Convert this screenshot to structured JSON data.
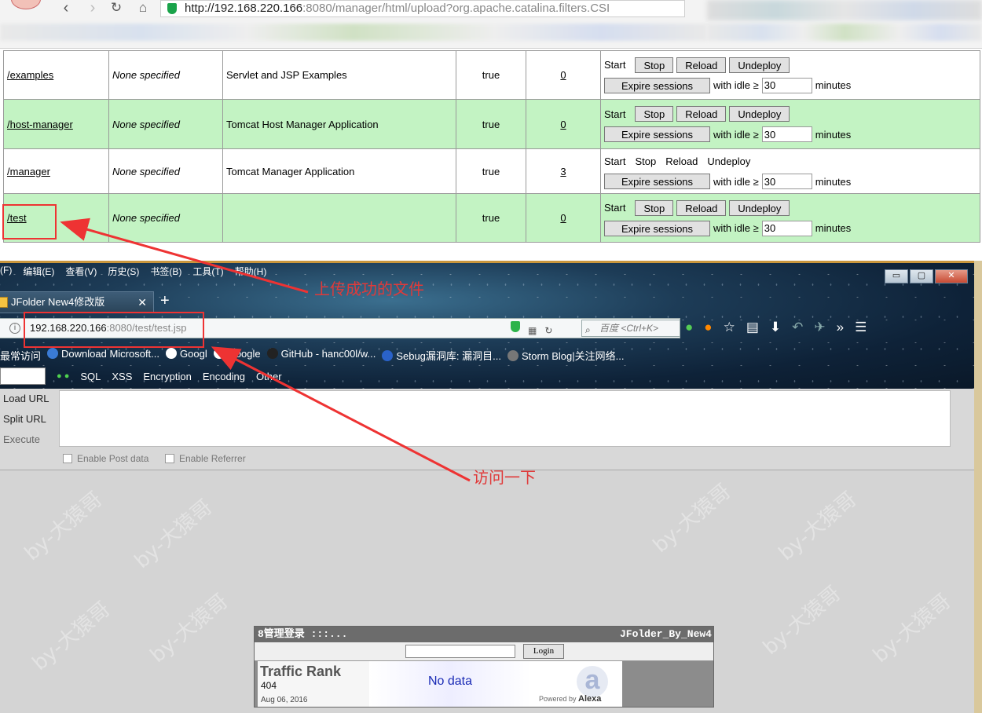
{
  "browser": {
    "url_host": "http://192.168.220.166",
    "url_rest": ":8080/manager/html/upload?org.apache.catalina.filters.CSI"
  },
  "manager": {
    "rows": [
      {
        "path": "/examples",
        "version": "None specified",
        "display": "Servlet and JSP Examples",
        "running": "true",
        "sessions": "0",
        "cmds_as_buttons": true
      },
      {
        "path": "/host-manager",
        "version": "None specified",
        "display": "Tomcat Host Manager Application",
        "running": "true",
        "sessions": "0",
        "cmds_as_buttons": true
      },
      {
        "path": "/manager",
        "version": "None specified",
        "display": "Tomcat Manager Application",
        "running": "true",
        "sessions": "3",
        "cmds_as_buttons": false
      },
      {
        "path": "/test",
        "version": "None specified",
        "display": "",
        "running": "true",
        "sessions": "0",
        "cmds_as_buttons": true
      }
    ],
    "labels": {
      "start": "Start",
      "stop": "Stop",
      "reload": "Reload",
      "undeploy": "Undeploy",
      "expire": "Expire sessions",
      "with_idle": "with idle ≥",
      "minutes": "minutes",
      "idle_value": "30"
    }
  },
  "firefox": {
    "menu": [
      "(F)",
      "编辑(E)",
      "查看(V)",
      "历史(S)",
      "书签(B)",
      "工具(T)",
      "帮助(H)"
    ],
    "window_buttons": [
      "▭",
      "▢",
      "✕"
    ],
    "tab_title": "JFolder New4修改版",
    "url_host": "192.168.220.166",
    "url_rest": ":8080/test/test.jsp",
    "search_placeholder": "百度 <Ctrl+K>",
    "bookmarks": [
      "最常访问",
      "Download Microsoft...",
      "Googl",
      "Google",
      "GitHub - hanc00l/w...",
      "Sebug漏洞库: 漏洞目...",
      "Storm Blog|关注网络..."
    ],
    "hackbar_menu": [
      "SQL",
      "XSS",
      "Encryption",
      "Encoding",
      "Other"
    ],
    "hackbar_side": [
      "Load URL",
      "Split URL",
      "Execute"
    ],
    "hackbar_checks": [
      "Enable Post data",
      "Enable Referrer"
    ]
  },
  "jfolder": {
    "title": "8管理登录 :::...",
    "brand": "JFolder_By_New4",
    "login_label": "Login",
    "traffic_rank": "Traffic Rank",
    "rank_value": "404",
    "date": "Aug 06, 2016",
    "no_data": "No data",
    "powered_by": "Powered by",
    "alexa": "Alexa"
  },
  "annotations": {
    "uploaded": "上传成功的文件",
    "visit": "访问一下"
  },
  "watermark": "by-大猿哥",
  "colors": {
    "alt_row": "#c3f3c3",
    "annotation": "#e03a3a"
  }
}
